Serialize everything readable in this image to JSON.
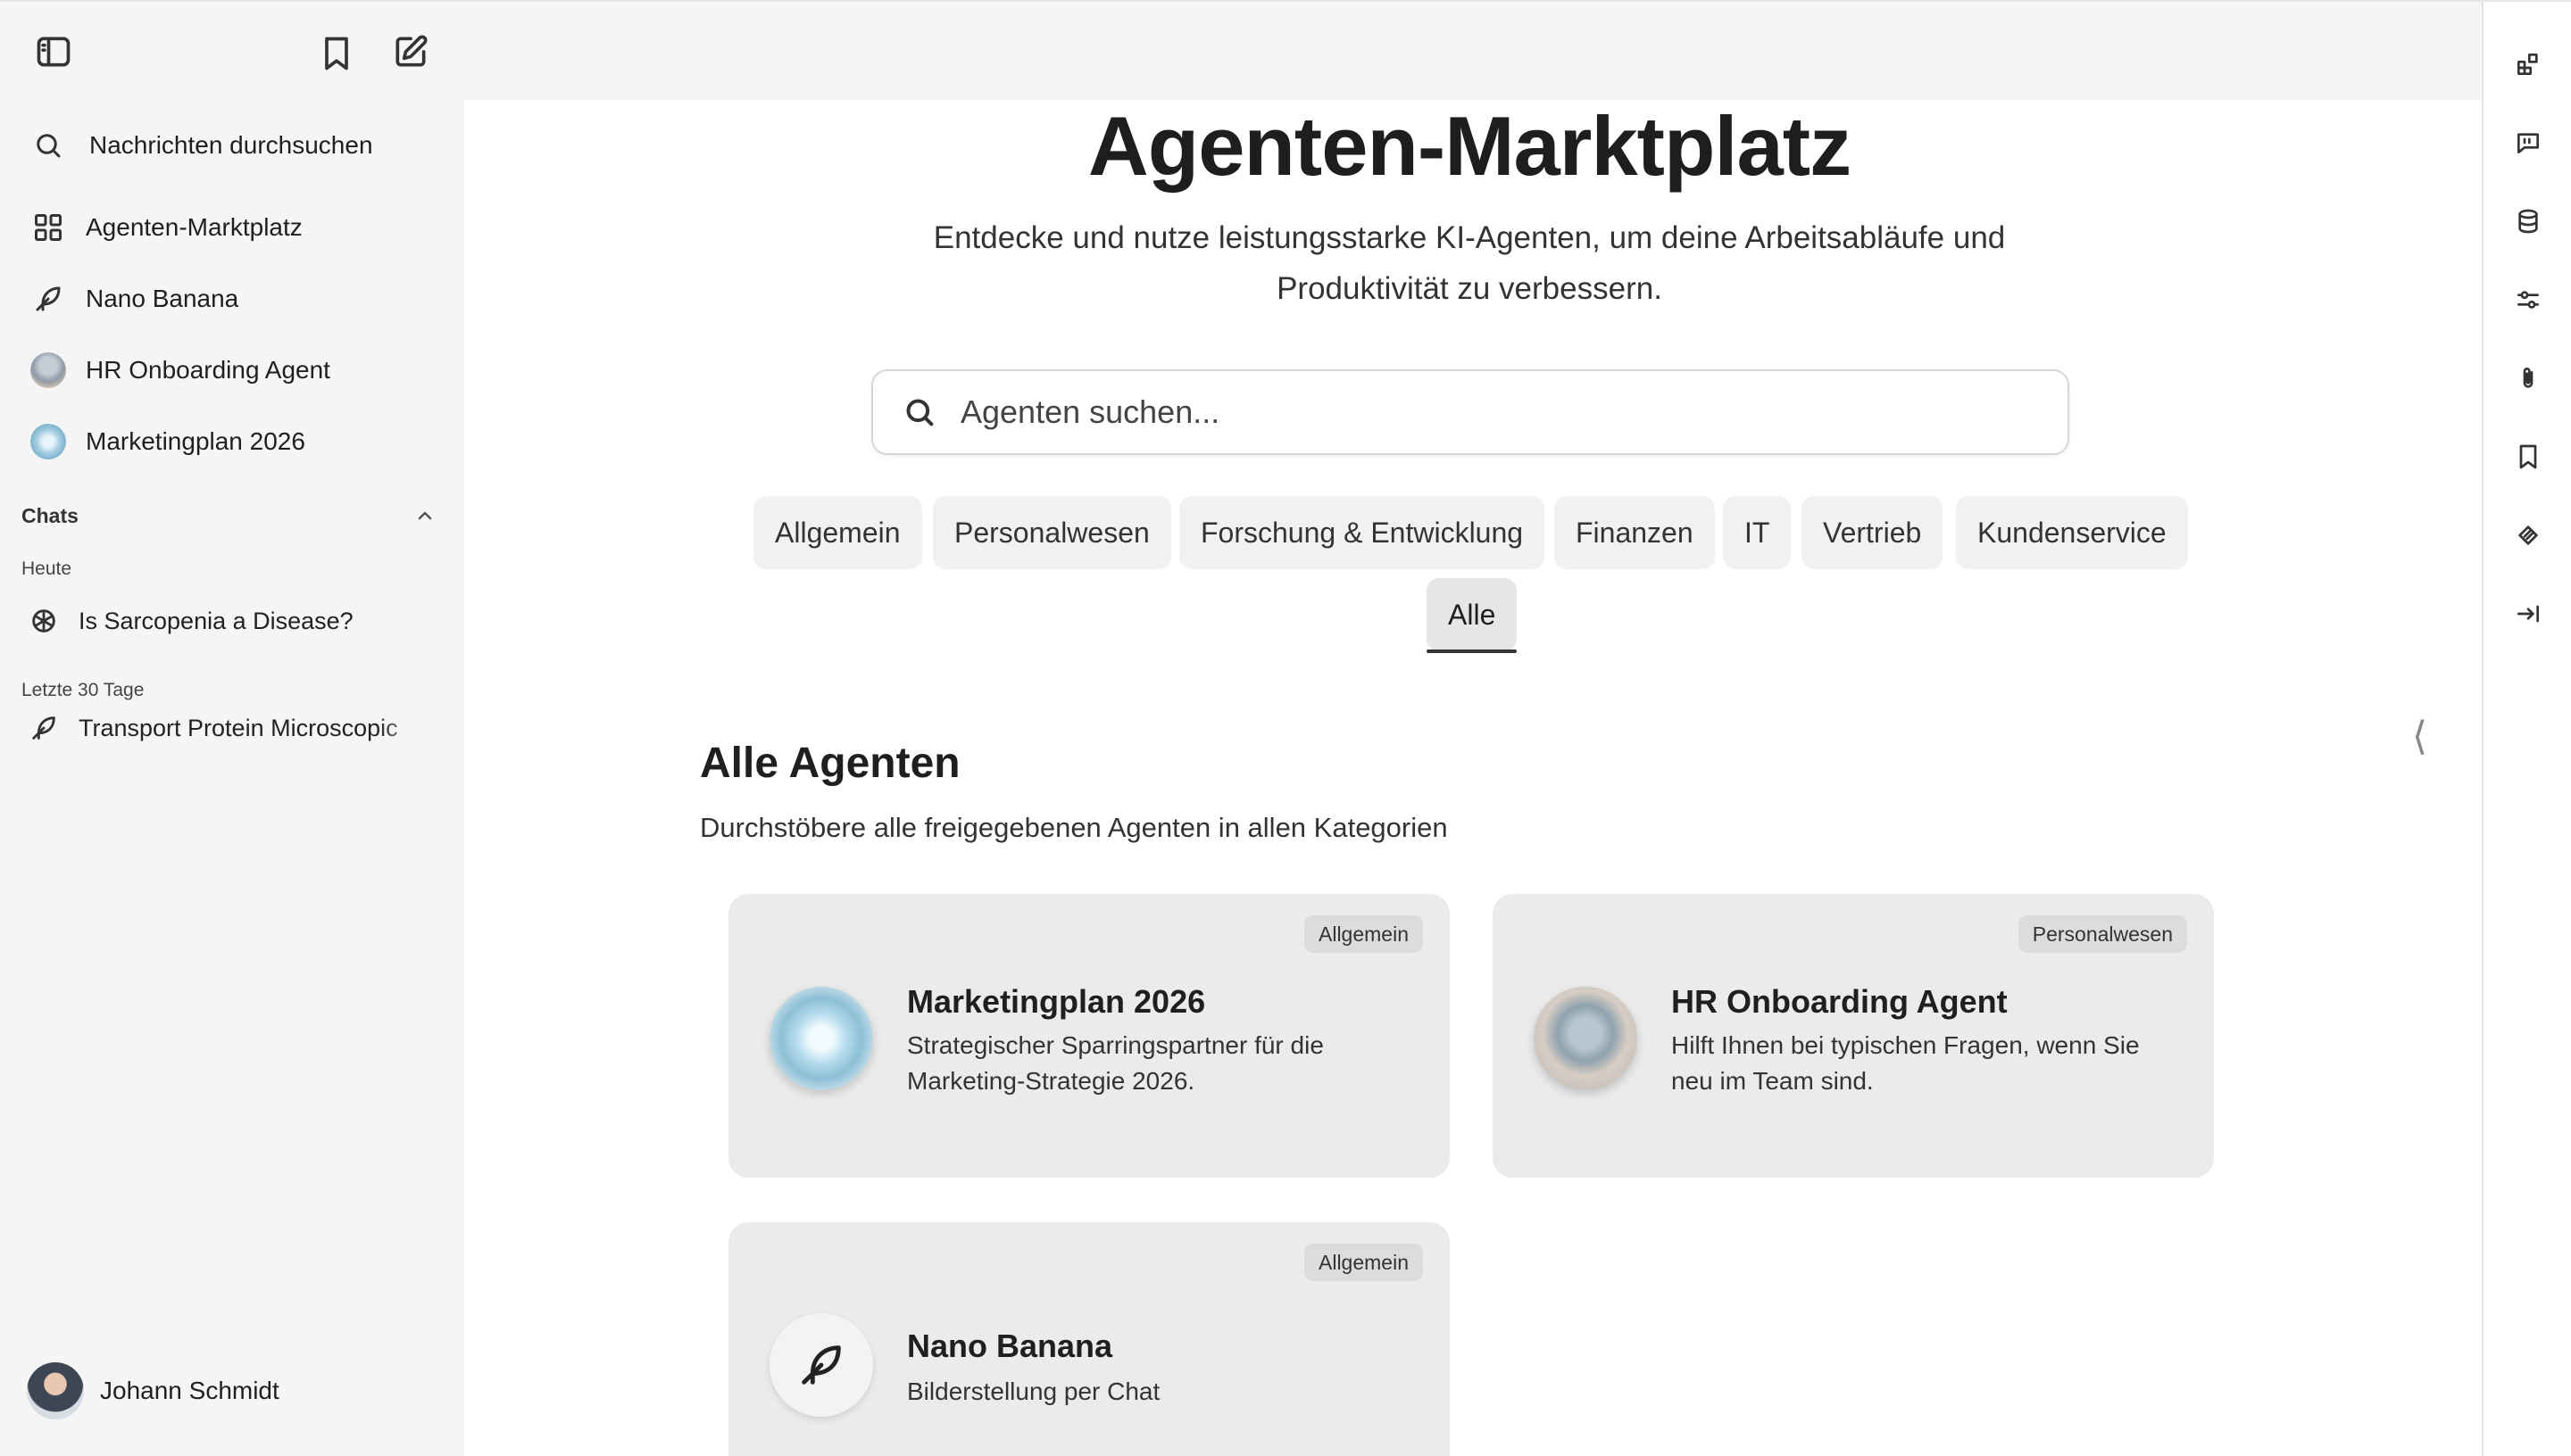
{
  "sidebar": {
    "search_label": "Nachrichten durchsuchen",
    "nav": [
      {
        "label": "Agenten-Marktplatz",
        "icon": "grid-icon"
      },
      {
        "label": "Nano Banana",
        "icon": "feather-icon"
      },
      {
        "label": "HR Onboarding Agent",
        "icon": "hr-onboarding-avatar"
      },
      {
        "label": "Marketingplan 2026",
        "icon": "marketingplan-avatar"
      }
    ],
    "chats_header": "Chats",
    "groups": [
      {
        "label": "Heute",
        "items": [
          {
            "label": "Is Sarcopenia a Disease?",
            "icon": "openai-icon"
          }
        ]
      },
      {
        "label": "Letzte 30 Tage",
        "items": [
          {
            "label": "Transport Protein Microscopic",
            "icon": "feather-icon"
          }
        ]
      }
    ],
    "user": {
      "name": "Johann Schmidt"
    }
  },
  "main": {
    "title": "Agenten-Marktplatz",
    "subtitle_line1": "Entdecke und nutze leistungsstarke KI-Agenten, um deine Arbeitsabläufe und",
    "subtitle_line2": "Produktivität zu verbessern.",
    "search_placeholder": "Agenten suchen...",
    "categories": [
      "Allgemein",
      "Personalwesen",
      "Forschung & Entwicklung",
      "Finanzen",
      "IT",
      "Vertrieb",
      "Kundenservice",
      "Alle"
    ],
    "active_category": "Alle",
    "section_title": "Alle Agenten",
    "section_subtitle": "Durchstöbere alle freigegebenen Agenten in allen Kategorien",
    "agents": [
      {
        "name": "Marketingplan 2026",
        "category": "Allgemein",
        "description": "Strategischer Sparringspartner für die Marketing-Strategie 2026."
      },
      {
        "name": "HR Onboarding Agent",
        "category": "Personalwesen",
        "description": "Hilft Ihnen bei typischen Fragen, wenn Sie neu im Team sind."
      },
      {
        "name": "Nano Banana",
        "category": "Allgemein",
        "description": "Bilderstellung per Chat"
      }
    ]
  },
  "right_rail": {
    "icons": [
      "widgets-icon",
      "message-icon",
      "database-icon",
      "sliders-icon",
      "paperclip-icon",
      "bookmark-icon",
      "layers-icon",
      "collapse-right-icon"
    ]
  },
  "colors": {
    "sidebar_bg": "#f5f5f5",
    "card_bg": "#ebebeb",
    "chip_bg": "#f1f1f1",
    "text": "#1f1f1f"
  }
}
